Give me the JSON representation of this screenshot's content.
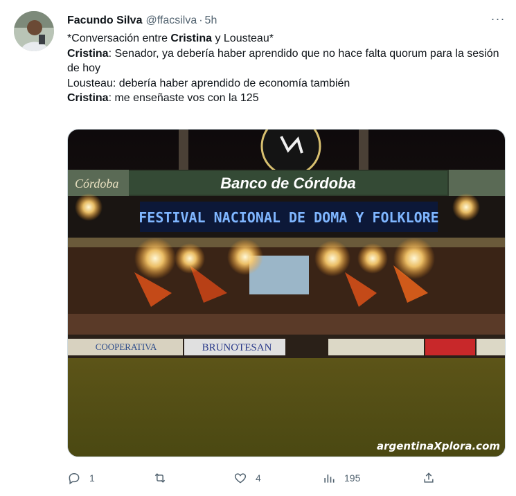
{
  "tweet": {
    "author_name": "Facundo Silva",
    "handle": "@ffacsilva",
    "separator": "·",
    "time": "5h",
    "more_label": "···",
    "lines": {
      "l1": "*Conversación entre ",
      "l1_b1": "Cristina",
      "l1_mid": " y Lousteau*",
      "l2_b": "Cristina",
      "l2": ": Senador, ya debería haber aprendido que no hace falta quorum para la sesión de hoy",
      "l3": "Lousteau: debería haber aprendido de economía también",
      "l4_b": "Cristina",
      "l4": ": me enseñaste vos con la 125"
    }
  },
  "image": {
    "sponsor_left": "Córdoba",
    "sponsor_main": "Banco de Córdoba",
    "banner": "FESTIVAL NACIONAL DE DOMA Y FOLKLORE",
    "sign_cooperativa": "COOPERATIVA",
    "sign_brunotesan": "BRUNOTESAN",
    "watermark": "argentinaXplora.com"
  },
  "actions": {
    "reply_count": "1",
    "retweet_count": "",
    "like_count": "4",
    "views_count": "195"
  },
  "icons": {
    "reply": "reply-icon",
    "retweet": "retweet-icon",
    "like": "heart-icon",
    "views": "views-icon",
    "share": "share-icon"
  }
}
